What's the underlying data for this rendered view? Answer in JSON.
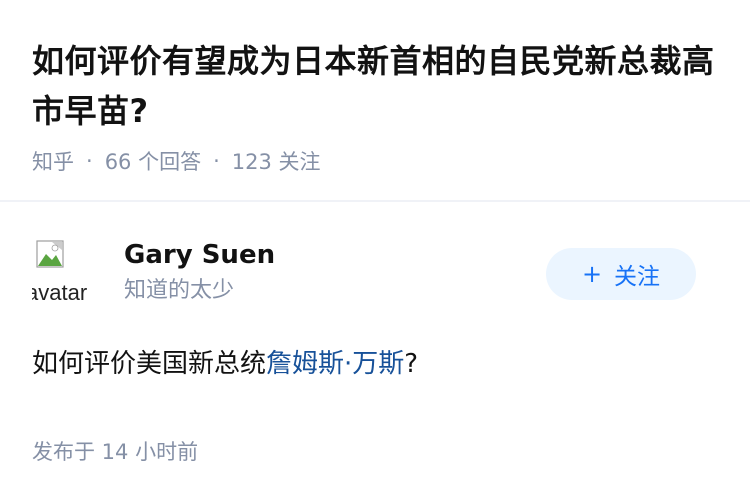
{
  "question": {
    "title": "如何评价有望成为日本新首相的自民党新总裁高市早苗?",
    "source": "知乎",
    "answers_count": "66 个回答",
    "followers_count": "123 关注"
  },
  "answer": {
    "author": {
      "name": "Gary Suen",
      "bio": "知道的太少",
      "avatar_alt": "avatar"
    },
    "follow_button": {
      "label": "关注",
      "icon": "plus-icon"
    },
    "content_prefix": "如何评价美国新总统",
    "content_link": "詹姆斯·万斯",
    "content_suffix": "?",
    "published": "发布于 14 小时前"
  },
  "colors": {
    "meta_gray": "#8590a6",
    "link_blue": "#175199",
    "button_bg": "#ebf5ff",
    "button_text": "#1772f6"
  }
}
